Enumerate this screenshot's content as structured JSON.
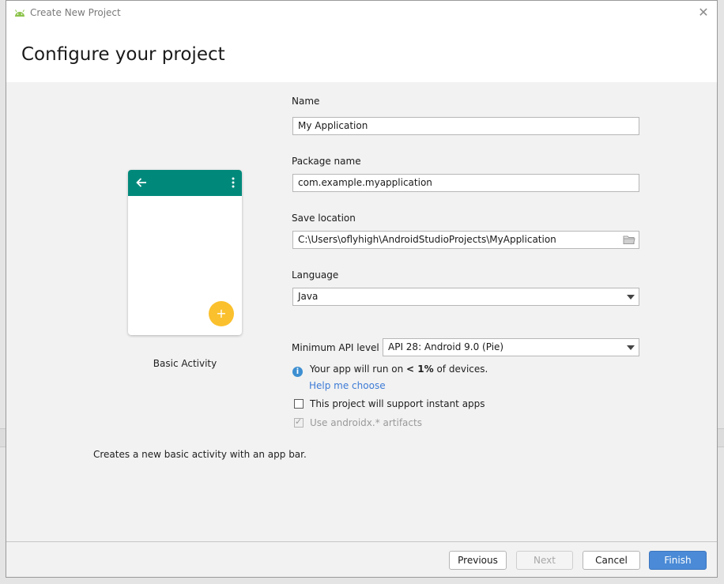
{
  "window": {
    "title": "Create New Project",
    "close_glyph": "✕",
    "heading": "Configure your project"
  },
  "preview": {
    "activity_label": "Basic Activity",
    "description": "Creates a new basic activity with an app bar.",
    "fab_glyph": "+",
    "appbar_color": "#00897b",
    "fab_color": "#fbc02d"
  },
  "form": {
    "name_label": "Name",
    "name_value": "My Application",
    "package_label": "Package name",
    "package_value": "com.example.myapplication",
    "save_label": "Save location",
    "save_value": "C:\\Users\\oflyhigh\\AndroidStudioProjects\\MyApplication",
    "language_label": "Language",
    "language_value": "Java",
    "min_api_label": "Minimum API level",
    "min_api_value": "API 28: Android 9.0 (Pie)",
    "info_icon_glyph": "i",
    "info_prefix": "Your app will run on",
    "info_percent": "< 1%",
    "info_suffix": "of devices.",
    "help_link": "Help me choose",
    "instant_apps_label": "This project will support instant apps",
    "androidx_label": "Use androidx.* artifacts",
    "androidx_check_glyph": "✓"
  },
  "buttons": {
    "previous": "Previous",
    "next": "Next",
    "cancel": "Cancel",
    "finish": "Finish"
  },
  "colors": {
    "primary_button": "#4a8ad6",
    "link": "#3d7bd6"
  }
}
